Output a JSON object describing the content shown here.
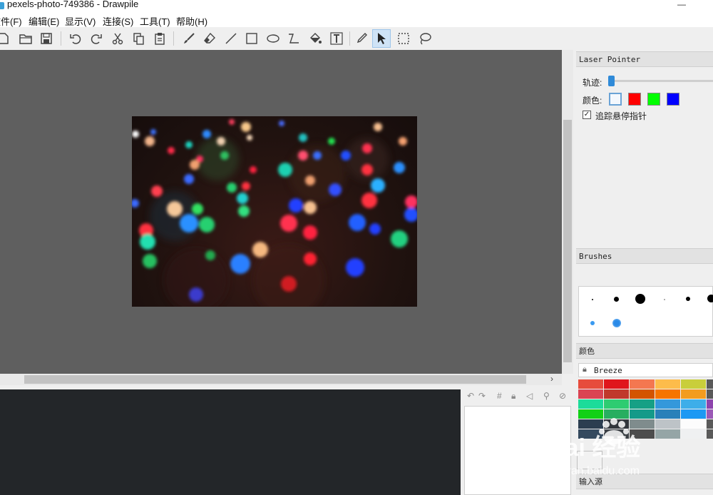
{
  "window": {
    "title": "pexels-photo-749386 - Drawpile",
    "minimize_glyph": "—"
  },
  "menu": [
    "文件(F)",
    "编辑(E)",
    "显示(V)",
    "连接(S)",
    "工具(T)",
    "帮助(H)"
  ],
  "toolbar": {
    "icons": [
      "new-icon",
      "open-icon",
      "save-icon",
      "undo-icon",
      "redo-icon",
      "cut-icon",
      "copy-icon",
      "paste-icon",
      "brush-icon",
      "eraser-icon",
      "line-icon",
      "rectangle-icon",
      "ellipse-icon",
      "bezier-icon",
      "fill-icon",
      "text-icon",
      "color-picker-icon",
      "laser-pointer-icon",
      "selection-icon",
      "lasso-icon"
    ],
    "active_tool": "laser-pointer-icon"
  },
  "laser_panel": {
    "title": "Laser Pointer",
    "trail_label": "轨迹:",
    "trail_value": 0,
    "color_label": "颜色:",
    "colors": [
      "#ffffff",
      "#ff0000",
      "#00ff00",
      "#0000ff"
    ],
    "selected_color_index": 0,
    "track_hover_label": "追踪悬停指针",
    "track_hover_checked": true,
    "check_glyph": "✓"
  },
  "brushes_panel": {
    "title": "Brushes"
  },
  "color_panel": {
    "title": "颜色",
    "palette_name": "Breeze",
    "rows": [
      [
        "#e74c3c",
        "#e0161c",
        "#f47750",
        "#fdbc4b",
        "#c9ce3b",
        "#5a5a5a"
      ],
      [
        "#da4453",
        "#c0392b",
        "#d35400",
        "#f67400",
        "#f39c1f",
        "#5a5a5a"
      ],
      [
        "#1cdc9a",
        "#2ecc71",
        "#16a085",
        "#3498db",
        "#3daee9",
        "#8e44ad"
      ],
      [
        "#11d116",
        "#27ae60",
        "#149a89",
        "#2980b9",
        "#1d99f3",
        "#9b59b6"
      ],
      [
        "#2c3e50",
        "#31363b",
        "#7f8c8d",
        "#bdc3c7",
        "#fcfcfc",
        "#5a5a5a"
      ],
      [
        "#34495e",
        "#3b4045",
        "#4d4d4d",
        "#95a5a6",
        "#eff0f1",
        "#5a5a5a"
      ]
    ]
  },
  "input_panel": {
    "title": "输入源"
  },
  "bottom_icons": [
    "undo-small-icon",
    "redo-small-icon",
    "grid-icon",
    "lock-small-icon",
    "annotation-icon",
    "user-lock-icon",
    "ban-icon"
  ],
  "watermark": {
    "text": "Bai 经验",
    "url": "jingyan.baidu.com"
  }
}
